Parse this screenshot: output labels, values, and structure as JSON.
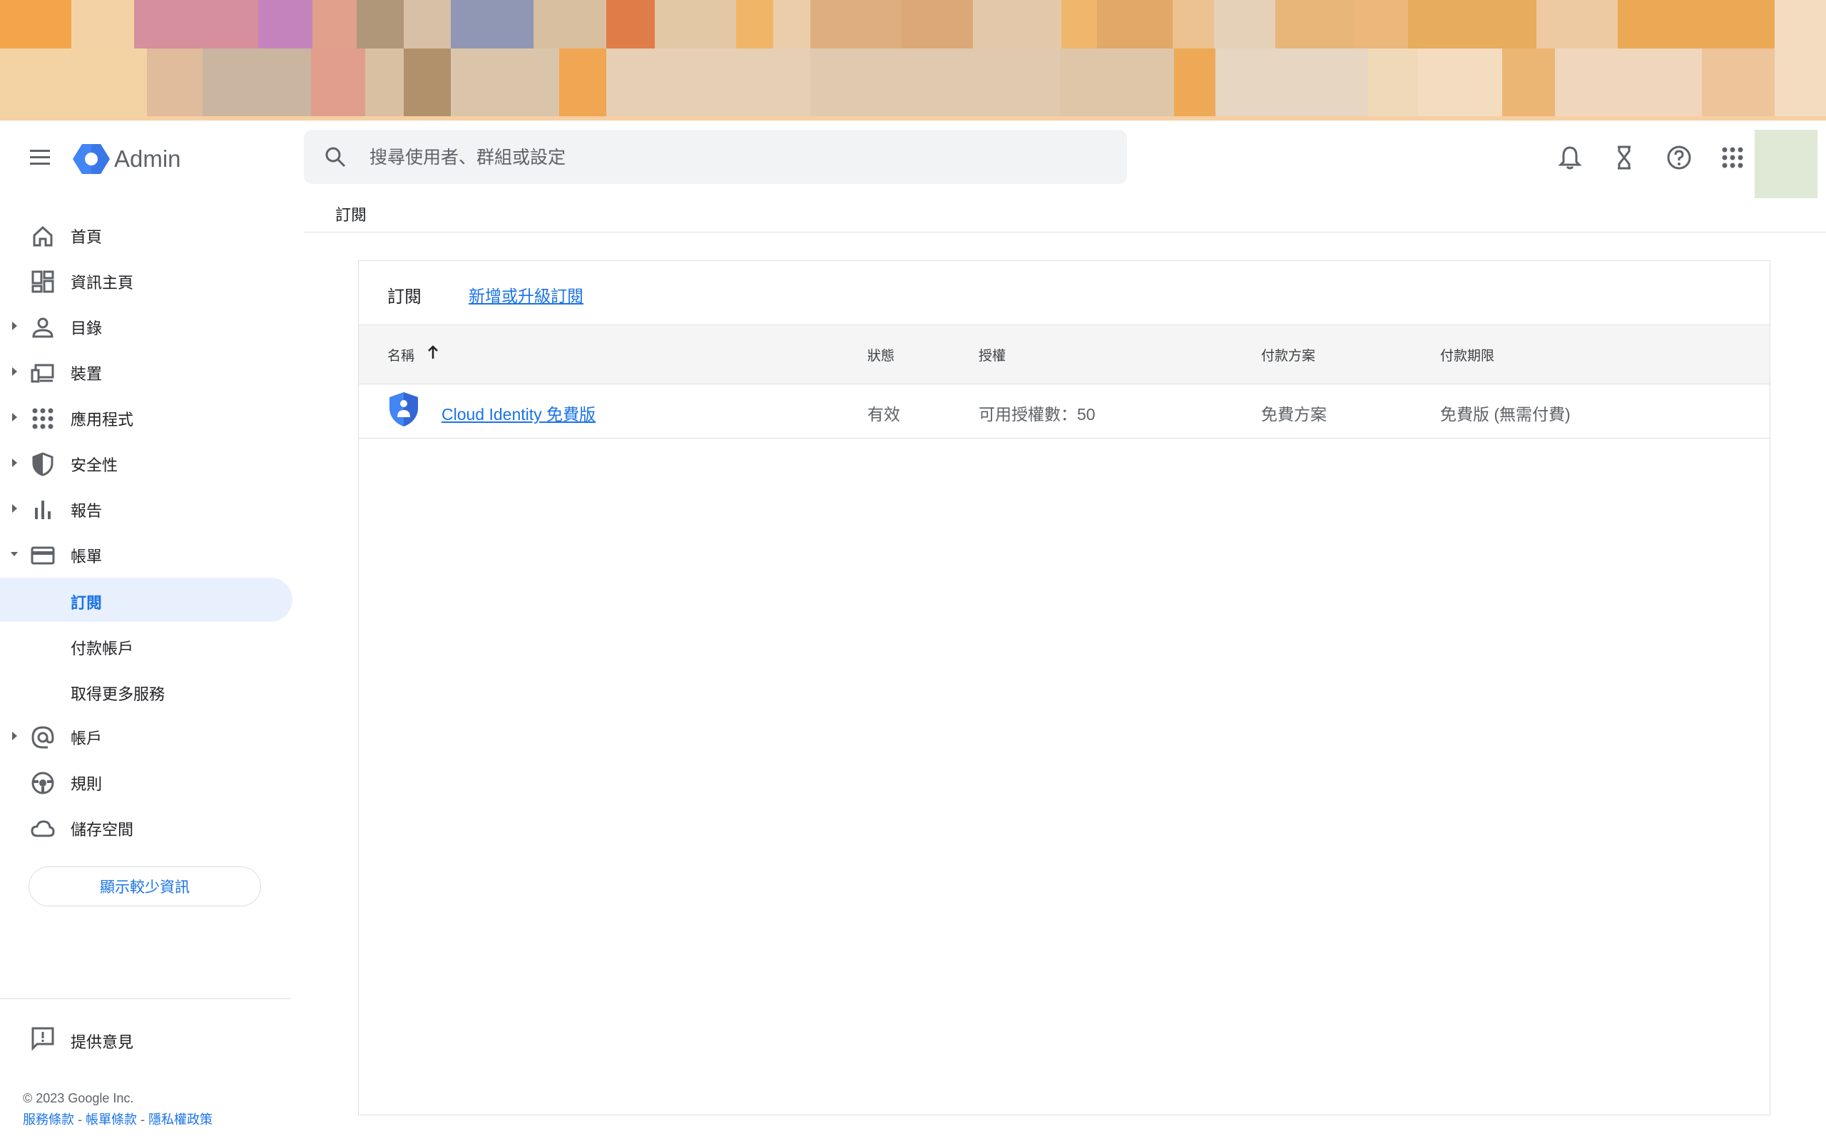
{
  "header": {
    "app_title": "Admin",
    "search_placeholder": "搜尋使用者、群組或設定",
    "icons": [
      "menu-icon",
      "admin-logo",
      "search-icon",
      "notifications-icon",
      "hourglass-icon",
      "help-icon",
      "apps-icon"
    ]
  },
  "breadcrumb": "訂閱",
  "sidebar": {
    "items": [
      {
        "label": "首頁",
        "icon": "home-icon",
        "expandable": false
      },
      {
        "label": "資訊主頁",
        "icon": "dashboard-icon",
        "expandable": false
      },
      {
        "label": "目錄",
        "icon": "person-icon",
        "expandable": true
      },
      {
        "label": "裝置",
        "icon": "devices-icon",
        "expandable": true
      },
      {
        "label": "應用程式",
        "icon": "apps-grid-icon",
        "expandable": true
      },
      {
        "label": "安全性",
        "icon": "shield-icon",
        "expandable": true
      },
      {
        "label": "報告",
        "icon": "bar-chart-icon",
        "expandable": true
      },
      {
        "label": "帳單",
        "icon": "credit-card-icon",
        "expandable": true,
        "expanded": true
      }
    ],
    "billing_sub": [
      {
        "label": "訂閱",
        "active": true
      },
      {
        "label": "付款帳戶",
        "active": false
      },
      {
        "label": "取得更多服務",
        "active": false
      }
    ],
    "items2": [
      {
        "label": "帳戶",
        "icon": "at-sign-icon",
        "expandable": true
      },
      {
        "label": "規則",
        "icon": "rules-icon",
        "expandable": false
      },
      {
        "label": "儲存空間",
        "icon": "cloud-icon",
        "expandable": false
      }
    ],
    "show_less": "顯示較少資訊",
    "feedback": "提供意見",
    "copyright": "© 2023 Google Inc.",
    "footer_links": [
      "服務條款",
      "帳單條款",
      "隱私權政策"
    ],
    "footer_sep": " - "
  },
  "card": {
    "title": "訂閱",
    "action_link": "新增或升級訂閱",
    "columns": {
      "name": "名稱",
      "status": "狀態",
      "license": "授權",
      "plan": "付款方案",
      "term": "付款期限"
    },
    "rows": [
      {
        "name": "Cloud Identity 免費版",
        "status": "有效",
        "license": "可用授權數：50",
        "plan": "免費方案",
        "term": "免費版 (無需付費)"
      }
    ]
  },
  "colors": {
    "accent": "#1a73e8",
    "active_bg": "#e8f0fe",
    "banner": "#f4a743"
  }
}
